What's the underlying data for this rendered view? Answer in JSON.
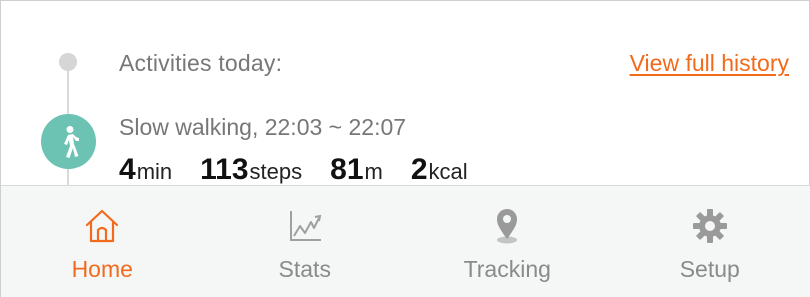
{
  "header": {
    "activities_label": "Activities today:",
    "history_link": "View full history"
  },
  "activity": {
    "icon": "walking-person-icon",
    "title": "Slow walking, 22:03 ~ 22:07",
    "stats": [
      {
        "value": "4",
        "unit": "min"
      },
      {
        "value": "113",
        "unit": "steps"
      },
      {
        "value": "81",
        "unit": "m"
      },
      {
        "value": "2",
        "unit": "kcal"
      }
    ]
  },
  "nav": {
    "items": [
      {
        "label": "Home",
        "icon": "home-icon",
        "active": true
      },
      {
        "label": "Stats",
        "icon": "chart-icon",
        "active": false
      },
      {
        "label": "Tracking",
        "icon": "location-pin-icon",
        "active": false
      },
      {
        "label": "Setup",
        "icon": "gear-icon",
        "active": false
      }
    ]
  },
  "colors": {
    "accent": "#f26a1b",
    "activity_icon_bg": "#6cc3b3",
    "nav_inactive": "#8a8a8a",
    "nav_bg": "#f5f7f7"
  }
}
